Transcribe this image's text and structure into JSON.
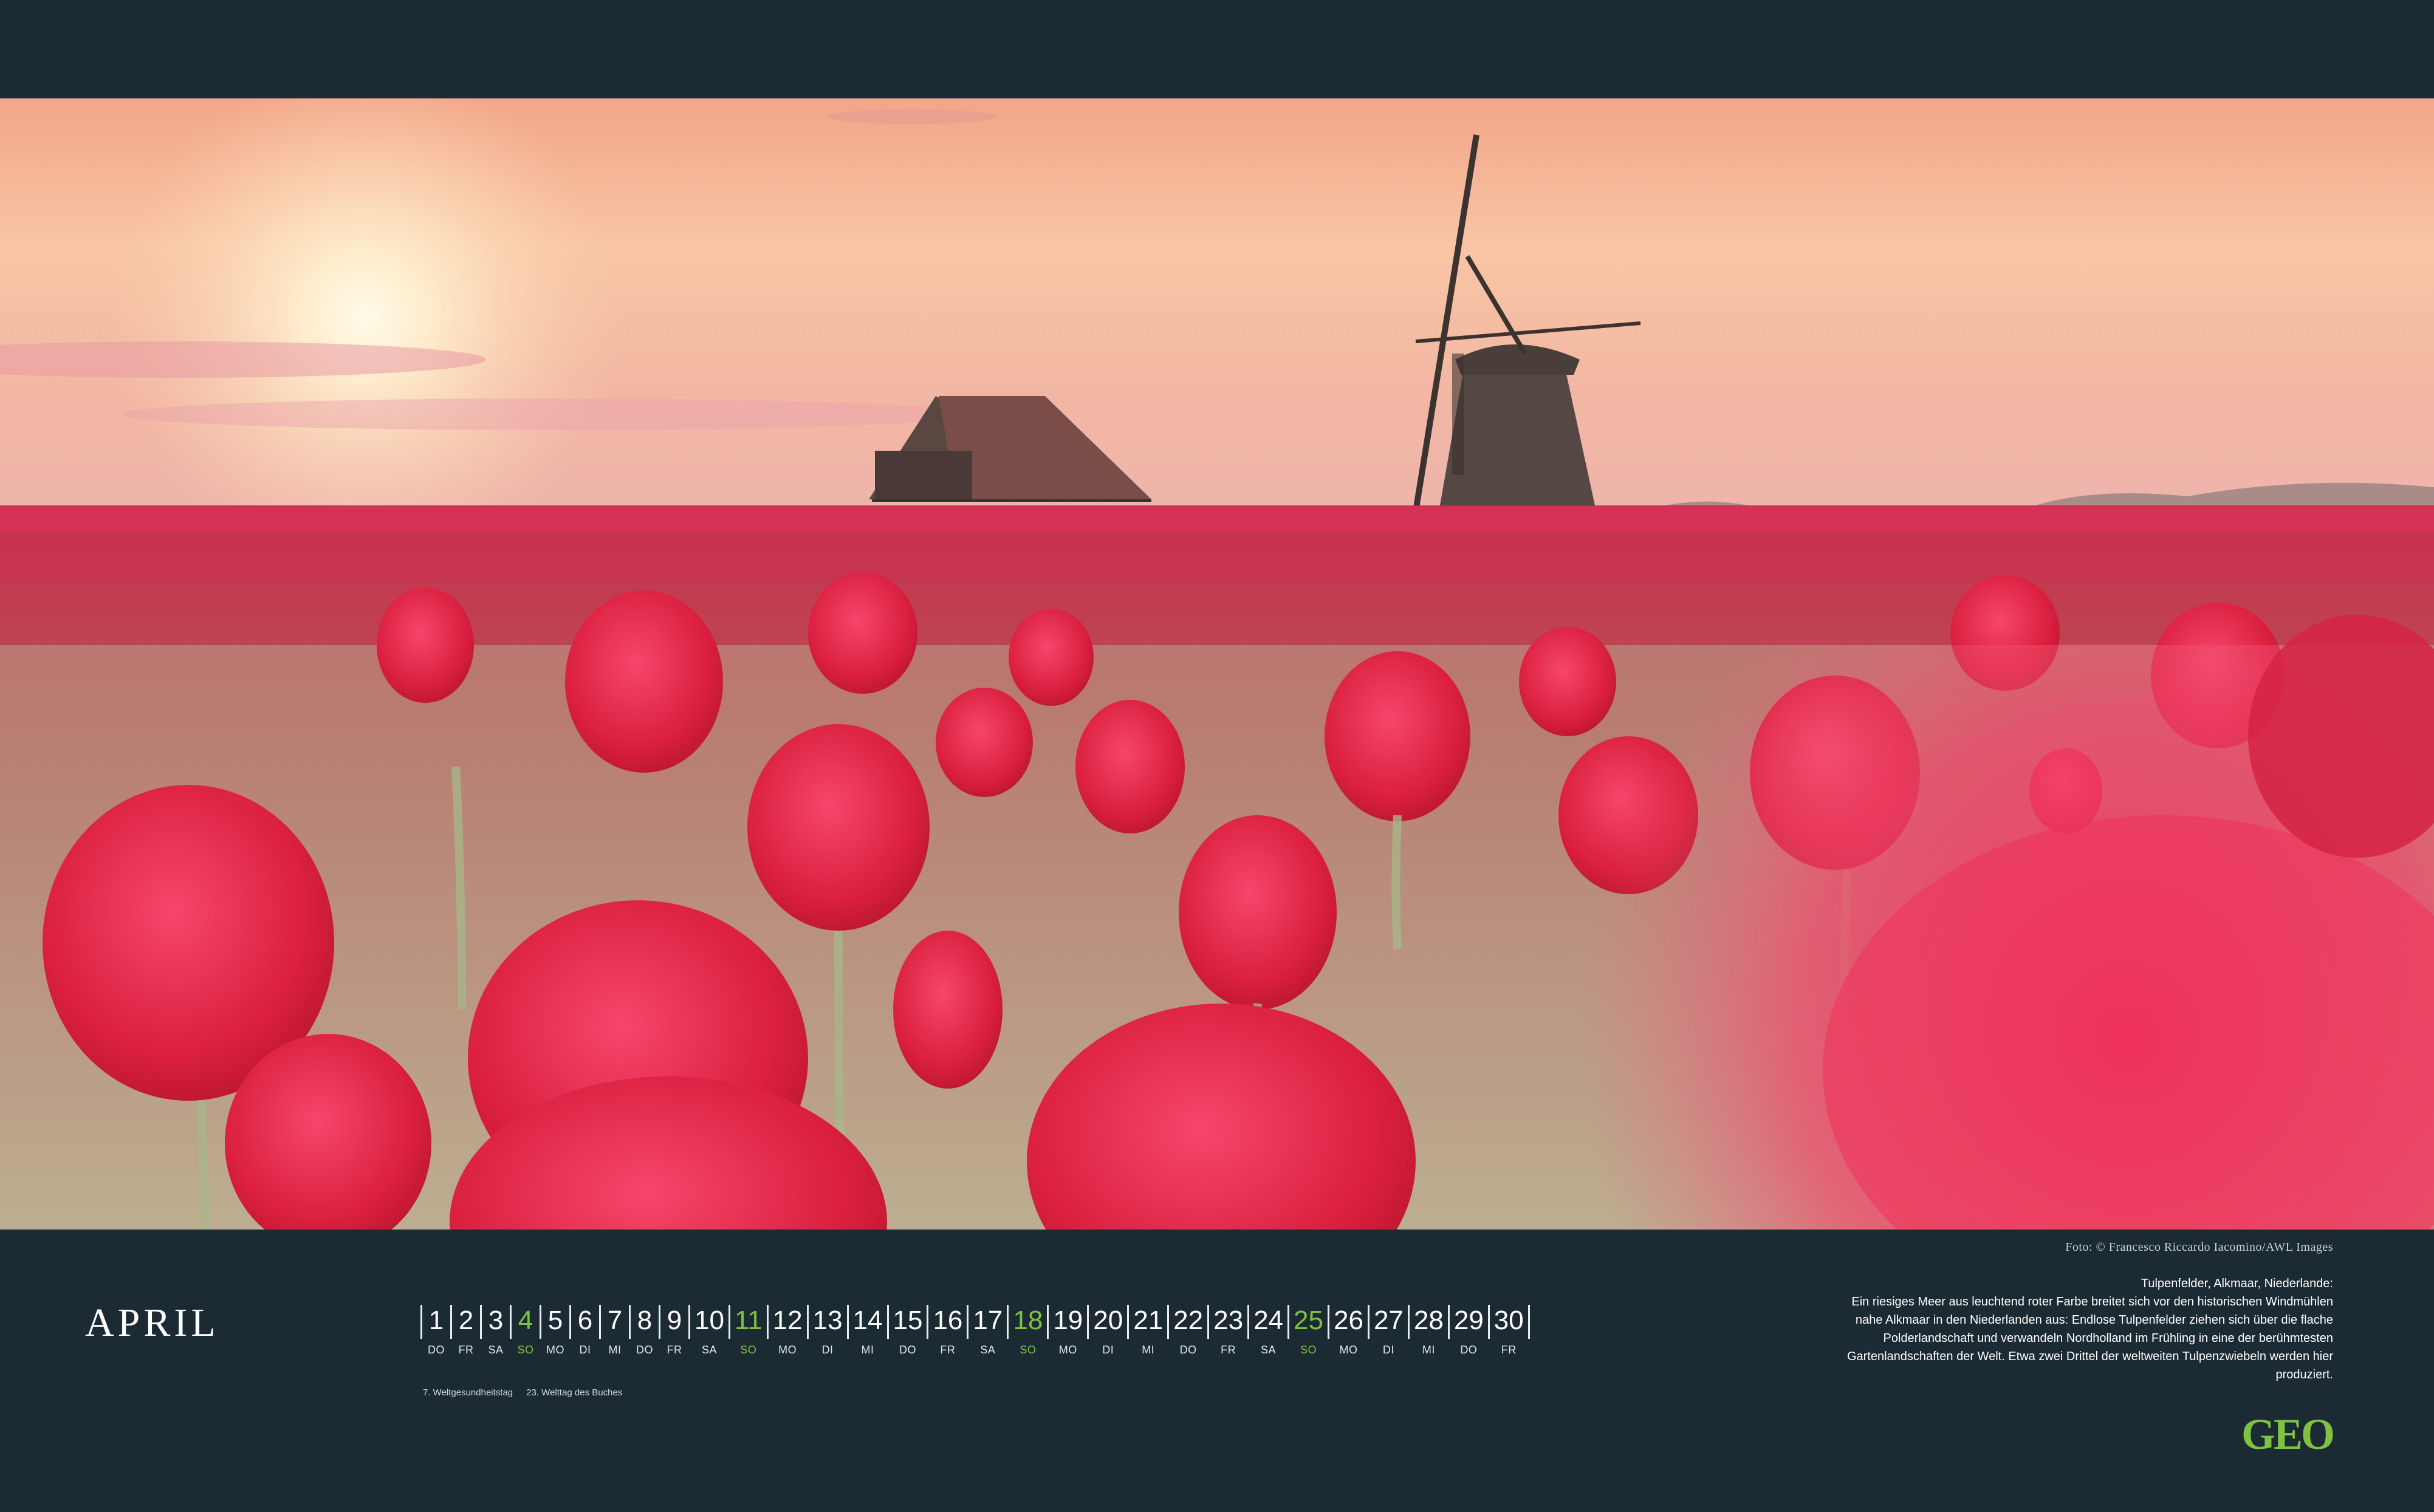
{
  "photo": {
    "credit": "Foto: © Francesco Riccardo Iacomino/AWL Images",
    "colors": {
      "sky_top": "#f3a78a",
      "sky_mid": "#f7c2a0",
      "sky_low": "#f0b2a8",
      "tulip": "#e0203f",
      "tulip_light": "#f04266",
      "stem": "#9fb08a"
    }
  },
  "calendar": {
    "month": "APRIL",
    "days": [
      {
        "num": "1",
        "wd": "DO",
        "sunday": false
      },
      {
        "num": "2",
        "wd": "FR",
        "sunday": false
      },
      {
        "num": "3",
        "wd": "SA",
        "sunday": false
      },
      {
        "num": "4",
        "wd": "SO",
        "sunday": true
      },
      {
        "num": "5",
        "wd": "MO",
        "sunday": false
      },
      {
        "num": "6",
        "wd": "DI",
        "sunday": false
      },
      {
        "num": "7",
        "wd": "MI",
        "sunday": false
      },
      {
        "num": "8",
        "wd": "DO",
        "sunday": false
      },
      {
        "num": "9",
        "wd": "FR",
        "sunday": false
      },
      {
        "num": "10",
        "wd": "SA",
        "sunday": false
      },
      {
        "num": "11",
        "wd": "SO",
        "sunday": true
      },
      {
        "num": "12",
        "wd": "MO",
        "sunday": false
      },
      {
        "num": "13",
        "wd": "DI",
        "sunday": false
      },
      {
        "num": "14",
        "wd": "MI",
        "sunday": false
      },
      {
        "num": "15",
        "wd": "DO",
        "sunday": false
      },
      {
        "num": "16",
        "wd": "FR",
        "sunday": false
      },
      {
        "num": "17",
        "wd": "SA",
        "sunday": false
      },
      {
        "num": "18",
        "wd": "SO",
        "sunday": true
      },
      {
        "num": "19",
        "wd": "MO",
        "sunday": false
      },
      {
        "num": "20",
        "wd": "DI",
        "sunday": false
      },
      {
        "num": "21",
        "wd": "MI",
        "sunday": false
      },
      {
        "num": "22",
        "wd": "DO",
        "sunday": false
      },
      {
        "num": "23",
        "wd": "FR",
        "sunday": false
      },
      {
        "num": "24",
        "wd": "SA",
        "sunday": false
      },
      {
        "num": "25",
        "wd": "SO",
        "sunday": true
      },
      {
        "num": "26",
        "wd": "MO",
        "sunday": false
      },
      {
        "num": "27",
        "wd": "DI",
        "sunday": false
      },
      {
        "num": "28",
        "wd": "MI",
        "sunday": false
      },
      {
        "num": "29",
        "wd": "DO",
        "sunday": false
      },
      {
        "num": "30",
        "wd": "FR",
        "sunday": false
      }
    ],
    "holidays": [
      "7. Weltgesundheitstag",
      "23. Welttag des Buches"
    ],
    "sunday_color": "#7fc242"
  },
  "caption": {
    "title": "Tulpenfelder, Alkmaar, Niederlande:",
    "lines": [
      "Ein riesiges Meer aus leuchtend roter Farbe breitet sich vor den historischen Windmühlen",
      "nahe Alkmaar in den Niederlanden aus: Endlose Tulpenfelder ziehen sich über die flache",
      "Polderlandschaft und verwandeln Nordholland im Frühling in eine der berühmtesten",
      "Gartenlandschaften der Welt. Etwa zwei Drittel der weltweiten Tulpenzwiebeln werden hier",
      "produziert."
    ]
  },
  "brand": {
    "logo": "GEO",
    "color": "#7fc242",
    "background": "#1b2a33"
  }
}
